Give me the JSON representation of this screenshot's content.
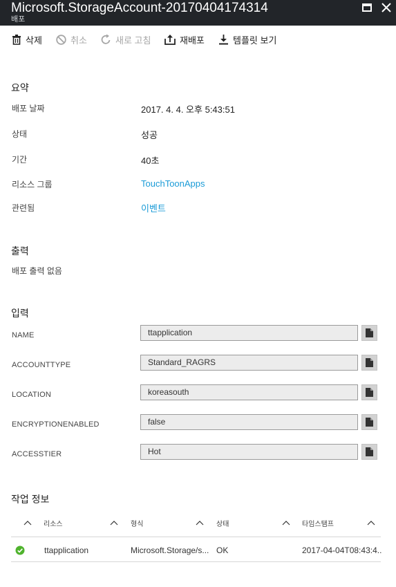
{
  "window": {
    "title": "Microsoft.StorageAccount-20170404174314",
    "subtitle": "배포"
  },
  "toolbar": {
    "delete_label": "삭제",
    "cancel_label": "취소",
    "refresh_label": "새로 고침",
    "redeploy_label": "재배포",
    "view_template_label": "템플릿 보기"
  },
  "summary": {
    "heading": "요약",
    "rows": [
      {
        "label": "배포 날짜",
        "value": "2017. 4. 4. 오후 5:43:51"
      },
      {
        "label": "상태",
        "value": "성공"
      },
      {
        "label": "기간",
        "value": "40초"
      },
      {
        "label": "리소스 그룹",
        "value": "TouchToonApps"
      },
      {
        "label": "관련됨",
        "value": "이벤트"
      }
    ]
  },
  "outputs": {
    "heading": "출력",
    "empty_text": "배포 출력 없음"
  },
  "inputs": {
    "heading": "입력",
    "params": [
      {
        "name": "NAME",
        "value": "ttapplication"
      },
      {
        "name": "ACCOUNTTYPE",
        "value": "Standard_RAGRS"
      },
      {
        "name": "LOCATION",
        "value": "koreasouth"
      },
      {
        "name": "ENCRYPTIONENABLED",
        "value": "false"
      },
      {
        "name": "ACCESSTIER",
        "value": "Hot"
      }
    ]
  },
  "operations": {
    "heading": "작업 정보",
    "columns": [
      "리소스",
      "형식",
      "상태",
      "타임스탬프"
    ],
    "rows": [
      {
        "resource": "ttapplication",
        "type": "Microsoft.Storage/s...",
        "status": "OK",
        "timestamp": "2017-04-04T08:43:4..."
      }
    ]
  },
  "colors": {
    "titlebar_bg": "#222529",
    "link": "#1a9bd7",
    "success_green": "#4fb32d",
    "disabled_text": "#a6a6a6"
  },
  "icons": [
    "maximize-icon",
    "close-icon",
    "trash-icon",
    "cancel-icon",
    "refresh-icon",
    "redeploy-icon",
    "download-icon",
    "copy-icon",
    "sort-chevron-up-icon",
    "success-check-icon"
  ]
}
